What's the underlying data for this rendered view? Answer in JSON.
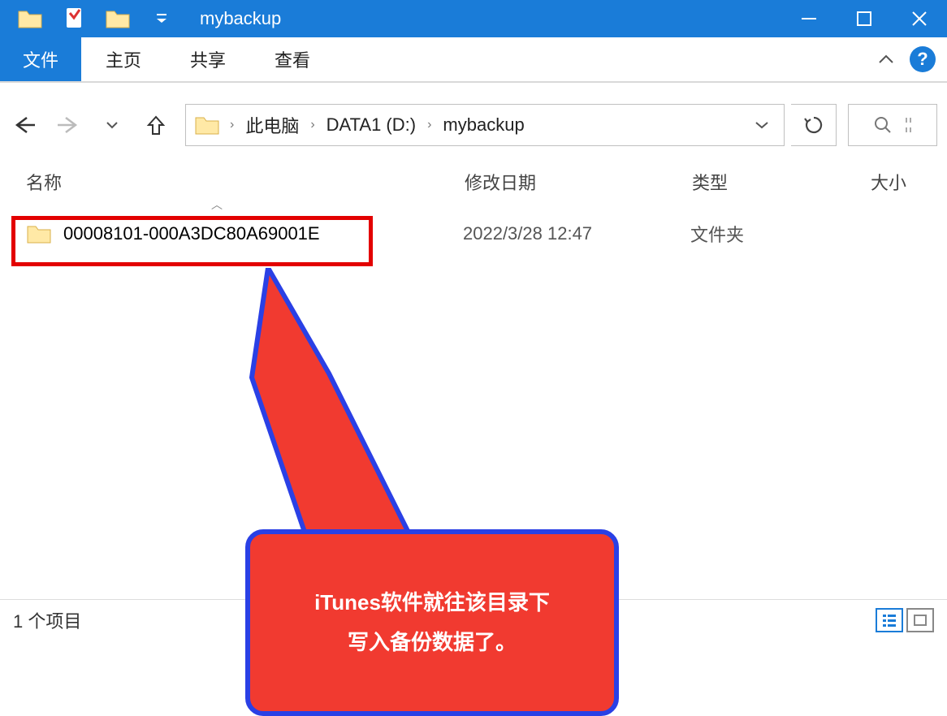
{
  "titlebar": {
    "title": "mybackup"
  },
  "ribbon": {
    "file_tab": "文件",
    "tabs": [
      "主页",
      "共享",
      "查看"
    ]
  },
  "breadcrumb": {
    "parts": [
      "此电脑",
      "DATA1 (D:)",
      "mybackup"
    ]
  },
  "columns": {
    "name": "名称",
    "date": "修改日期",
    "type": "类型",
    "size": "大小"
  },
  "rows": [
    {
      "name": "00008101-000A3DC80A69001E",
      "date": "2022/3/28 12:47",
      "type": "文件夹",
      "size": ""
    }
  ],
  "annotation": {
    "line1": "iTunes软件就往该目录下",
    "line2": "写入备份数据了。"
  },
  "statusbar": {
    "count_text": "1 个项目"
  }
}
